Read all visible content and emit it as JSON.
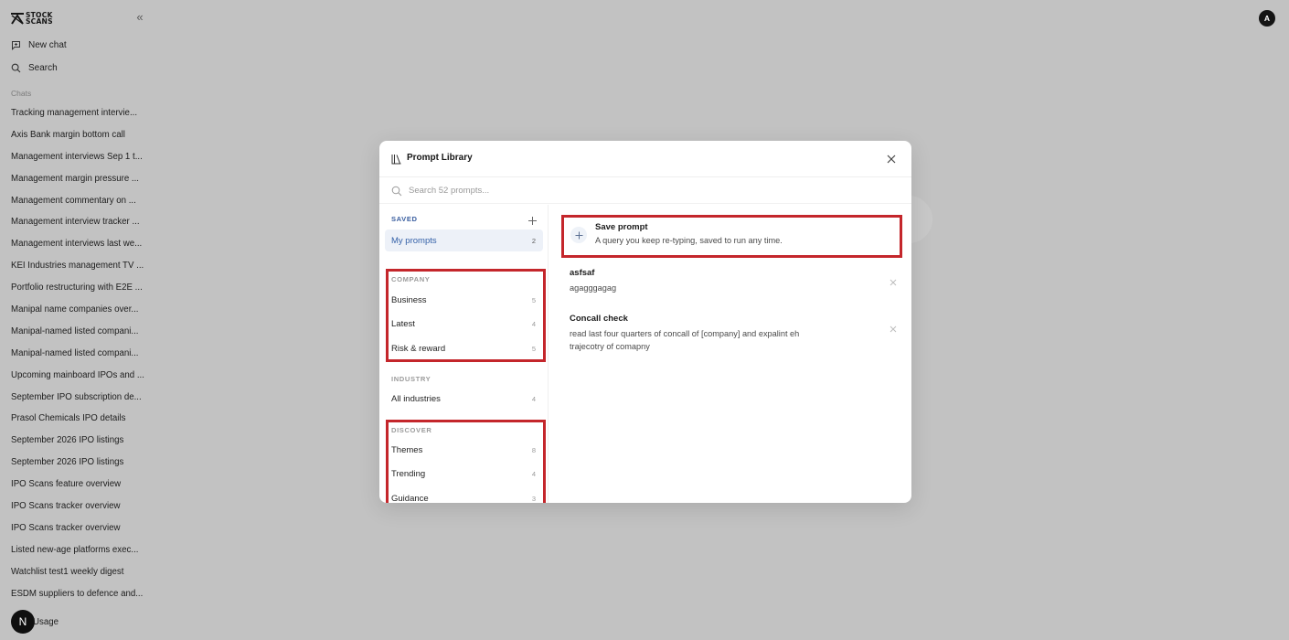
{
  "sidebar": {
    "brand": {
      "line1": "STOCK",
      "line2": "SCANS"
    },
    "collapse_glyph": "«",
    "new_chat_label": "New chat",
    "search_label": "Search",
    "chats_heading": "Chats",
    "chats": [
      "Tracking management intervie...",
      "Axis Bank margin bottom call",
      "Management interviews Sep 1 t...",
      "Management margin pressure ...",
      "Management commentary on ...",
      "Management interview tracker ...",
      "Management interviews last we...",
      "KEI Industries management TV ...",
      "Portfolio restructuring with E2E ...",
      "Manipal name companies over...",
      "Manipal-named listed compani...",
      "Manipal-named listed compani...",
      "Upcoming mainboard IPOs and ...",
      "September IPO subscription de...",
      "Prasol Chemicals IPO details",
      "September 2026 IPO listings",
      "September 2026 IPO listings",
      "IPO Scans feature overview",
      "IPO Scans tracker overview",
      "IPO Scans tracker overview",
      "Listed new-age platforms exec...",
      "Watchlist test1 weekly digest",
      "ESDM suppliers to defence and..."
    ],
    "usage_badge": "N",
    "usage_label": "Usage"
  },
  "header": {
    "avatar_initial": "A"
  },
  "modal": {
    "title": "Prompt Library",
    "search_placeholder": "Search 52 prompts...",
    "saved": {
      "heading": "SAVED",
      "items": [
        {
          "label": "My prompts",
          "count": "2"
        }
      ]
    },
    "company": {
      "heading": "COMPANY",
      "items": [
        {
          "label": "Business",
          "count": "5"
        },
        {
          "label": "Latest",
          "count": "4"
        },
        {
          "label": "Risk & reward",
          "count": "5"
        }
      ]
    },
    "industry": {
      "heading": "INDUSTRY",
      "items": [
        {
          "label": "All industries",
          "count": "4"
        }
      ]
    },
    "discover": {
      "heading": "DISCOVER",
      "items": [
        {
          "label": "Themes",
          "count": "8"
        },
        {
          "label": "Trending",
          "count": "4"
        },
        {
          "label": "Guidance",
          "count": "3"
        }
      ]
    },
    "save_prompt": {
      "title": "Save prompt",
      "subtitle": "A query you keep re-typing, saved to run any time."
    },
    "prompts": [
      {
        "title": "asfsaf",
        "body": "agagggagag"
      },
      {
        "title": "Concall check",
        "body": "read last four quarters of concall of [company] and expalint eh trajecotry of comapny"
      }
    ]
  },
  "colors": {
    "overlay": "#c2c2c2",
    "highlight_box": "#c4262b",
    "saved_accent": "#3b5fa0",
    "active_item_bg": "#edf1f8"
  }
}
